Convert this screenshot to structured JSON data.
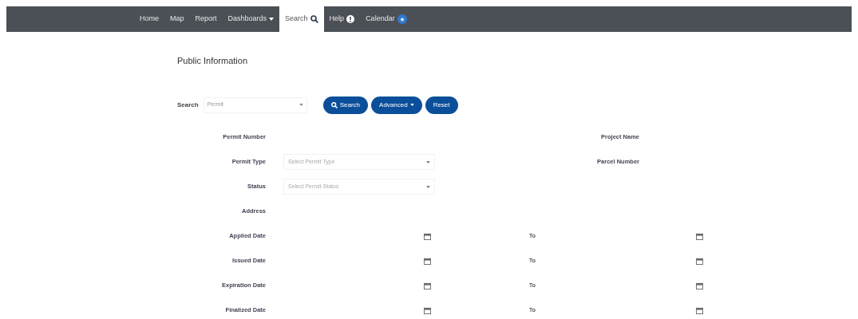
{
  "nav": [
    {
      "label": "Home",
      "selected": false,
      "kind": "plain"
    },
    {
      "label": "Map",
      "selected": false,
      "kind": "plain"
    },
    {
      "label": "Report",
      "selected": false,
      "kind": "plain"
    },
    {
      "label": "Dashboards",
      "selected": false,
      "kind": "dropdown"
    },
    {
      "label": "Search",
      "selected": true,
      "kind": "search"
    },
    {
      "label": "Help",
      "selected": false,
      "kind": "help"
    },
    {
      "label": "Calendar",
      "selected": false,
      "kind": "calendar"
    }
  ],
  "title": "Public Information",
  "search": {
    "label": "Search",
    "value": "Permit",
    "buttons": [
      {
        "label": "Search",
        "kind": "search"
      },
      {
        "label": "Advanced",
        "kind": "dropdown"
      },
      {
        "label": "Reset",
        "kind": "plain"
      }
    ]
  },
  "fields": [
    {
      "kind": "text",
      "label": "Permit Number",
      "right_label": "Project Name"
    },
    {
      "kind": "select",
      "label": "Permit Type",
      "placeholder": "Select Permit Type",
      "right_label": "Parcel Number"
    },
    {
      "kind": "select",
      "label": "Status",
      "placeholder": "Select Permit Status"
    },
    {
      "kind": "text",
      "label": "Address"
    },
    {
      "kind": "daterange",
      "label": "Applied Date",
      "to": "To"
    },
    {
      "kind": "daterange",
      "label": "Issued Date",
      "to": "To"
    },
    {
      "kind": "daterange",
      "label": "Expiration Date",
      "to": "To"
    },
    {
      "kind": "daterange",
      "label": "Finalized Date",
      "to": "To"
    }
  ]
}
